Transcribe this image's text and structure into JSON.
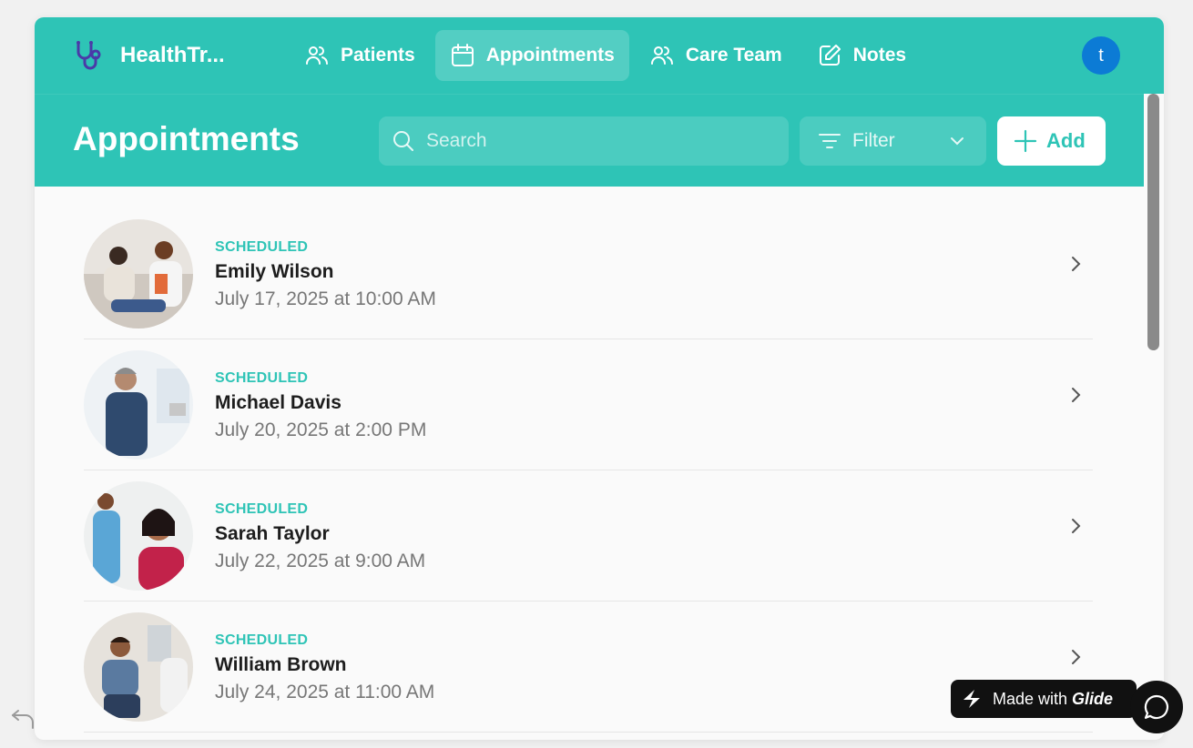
{
  "app": {
    "brand_name": "HealthTr...",
    "nav": [
      {
        "label": "Patients",
        "icon": "users-icon",
        "active": false
      },
      {
        "label": "Appointments",
        "icon": "calendar-icon",
        "active": true
      },
      {
        "label": "Care Team",
        "icon": "users-icon",
        "active": false
      },
      {
        "label": "Notes",
        "icon": "edit-icon",
        "active": false
      }
    ],
    "avatar_initial": "t"
  },
  "page": {
    "title": "Appointments",
    "search_placeholder": "Search",
    "filter_label": "Filter",
    "add_label": "Add"
  },
  "appointments": [
    {
      "status": "SCHEDULED",
      "name": "Emily Wilson",
      "when": "July 17, 2025 at 10:00 AM"
    },
    {
      "status": "SCHEDULED",
      "name": "Michael Davis",
      "when": "July 20, 2025 at 2:00 PM"
    },
    {
      "status": "SCHEDULED",
      "name": "Sarah Taylor",
      "when": "July 22, 2025 at 9:00 AM"
    },
    {
      "status": "SCHEDULED",
      "name": "William Brown",
      "when": "July 24, 2025 at 11:00 AM"
    }
  ],
  "badge": {
    "made_with": "Made with",
    "brand": "Glide"
  },
  "colors": {
    "accent": "#2ec4b6",
    "avatar": "#0c7bd5",
    "dark": "#111111"
  }
}
